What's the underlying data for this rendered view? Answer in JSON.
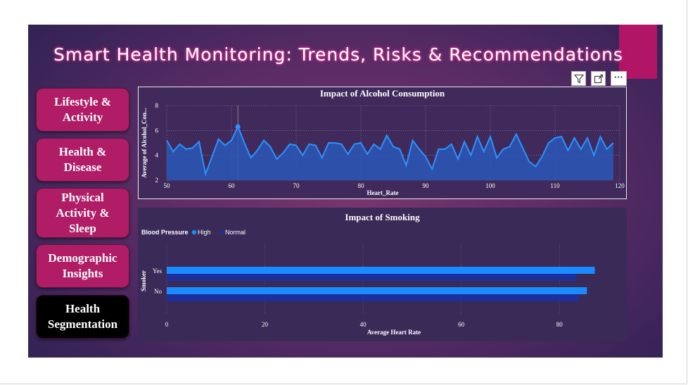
{
  "title": "Smart Health Monitoring: Trends, Risks & Recommendations",
  "nav": [
    {
      "label": "Lifestyle & Activity",
      "lines": [
        "Lifestyle &",
        "Activity"
      ]
    },
    {
      "label": "Health & Disease",
      "lines": [
        "Health &",
        "Disease"
      ]
    },
    {
      "label": "Physical Activity & Sleep",
      "lines": [
        "Physical",
        "Activity &",
        "Sleep"
      ]
    },
    {
      "label": "Demographic Insights",
      "lines": [
        "Demographic",
        "Insights"
      ]
    },
    {
      "label": "Health Segmentation",
      "lines": [
        "Health",
        "Segmentation"
      ],
      "active": true
    }
  ],
  "toolbar": {
    "icons": [
      "filter-icon",
      "expand-icon",
      "more-options-icon"
    ],
    "more_label": "···"
  },
  "colors": {
    "accent": "#b11565",
    "nav": "#b01d66",
    "line": "#1e90ff",
    "bar_high": "#1a8cff",
    "bar_normal": "#1d2f9a"
  },
  "chart_data": [
    {
      "type": "area",
      "title": "Impact of Alcohol Consumption",
      "xlabel": "Heart_Rate",
      "ylabel": "Average of Alcohol_Con...",
      "xlim": [
        50,
        120
      ],
      "ylim": [
        2,
        8
      ],
      "xticks": [
        50,
        60,
        70,
        80,
        90,
        100,
        110,
        120
      ],
      "yticks": [
        2,
        4,
        6,
        8
      ],
      "grid": true,
      "highlight_x": 61,
      "x": [
        50,
        51,
        52,
        53,
        54,
        55,
        56,
        57,
        58,
        59,
        60,
        61,
        62,
        63,
        64,
        65,
        66,
        67,
        68,
        69,
        70,
        71,
        72,
        73,
        74,
        75,
        76,
        77,
        78,
        79,
        80,
        81,
        82,
        83,
        84,
        85,
        86,
        87,
        88,
        89,
        90,
        91,
        92,
        93,
        94,
        95,
        96,
        97,
        98,
        99,
        100,
        101,
        102,
        103,
        104,
        105,
        106,
        107,
        108,
        109,
        110,
        111,
        112,
        113,
        114,
        115,
        116,
        117,
        118,
        119
      ],
      "y": [
        5.2,
        4.3,
        4.9,
        4.5,
        4.6,
        5.1,
        2.5,
        3.9,
        5.3,
        4.8,
        5.2,
        6.3,
        5.0,
        3.8,
        4.4,
        5.2,
        4.7,
        3.7,
        4.2,
        4.9,
        4.8,
        4.0,
        4.9,
        4.8,
        3.8,
        5.0,
        5.0,
        4.9,
        4.1,
        4.9,
        5.0,
        4.1,
        4.9,
        4.5,
        5.6,
        4.7,
        4.5,
        3.2,
        5.2,
        4.5,
        3.9,
        2.9,
        4.5,
        4.5,
        4.9,
        3.7,
        5.1,
        4.0,
        5.5,
        4.3,
        5.5,
        3.8,
        4.5,
        4.7,
        5.7,
        4.6,
        3.5,
        3.1,
        3.9,
        5.0,
        5.4,
        5.5,
        4.4,
        5.4,
        4.5,
        5.4,
        4.0,
        5.5,
        4.5,
        5.0
      ]
    },
    {
      "type": "bar",
      "orientation": "horizontal",
      "title": "Impact of Smoking",
      "legend_title": "Blood Pressure",
      "legend_position": "top-left",
      "categories": [
        "Yes",
        "No"
      ],
      "ylabel": "Smoker",
      "xlabel": "Average Heart Rate",
      "xlim": [
        0,
        90
      ],
      "xticks": [
        0,
        20,
        40,
        60,
        80
      ],
      "grid": true,
      "series": [
        {
          "name": "High",
          "values": [
            87.2,
            85.6
          ]
        },
        {
          "name": "Normal",
          "values": [
            83.5,
            84.0
          ]
        }
      ]
    }
  ]
}
